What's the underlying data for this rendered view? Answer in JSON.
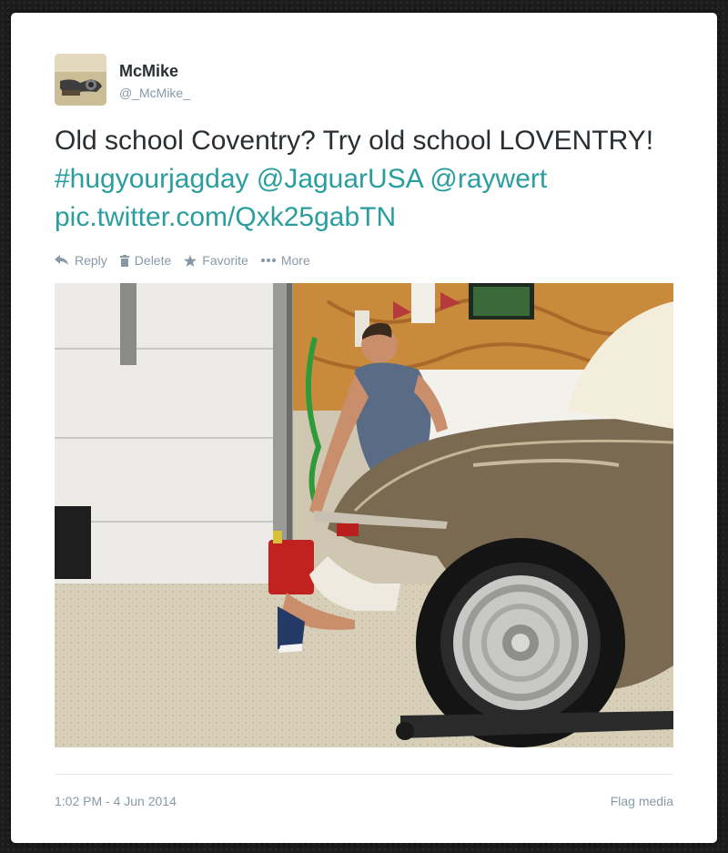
{
  "user": {
    "name": "McMike",
    "handle": "@_McMike_"
  },
  "tweet": {
    "text_plain": "Old school Coventry? Try old school LOVENTRY!",
    "hashtag": "#hugyourjagday",
    "mention_1": "@JaguarUSA",
    "mention_2": "@raywert",
    "link": "pic.twitter.com/Qxk25gabTN"
  },
  "actions": {
    "reply": "Reply",
    "delete": "Delete",
    "favorite": "Favorite",
    "more": "More"
  },
  "footer": {
    "timestamp": "1:02 PM - 4 Jun 2014",
    "flag_media": "Flag media"
  },
  "colors": {
    "link": "#2a9d9f",
    "muted": "#8899a6",
    "text": "#292f33"
  },
  "icons": [
    "reply-icon",
    "trash-icon",
    "star-icon",
    "more-dots-icon"
  ]
}
